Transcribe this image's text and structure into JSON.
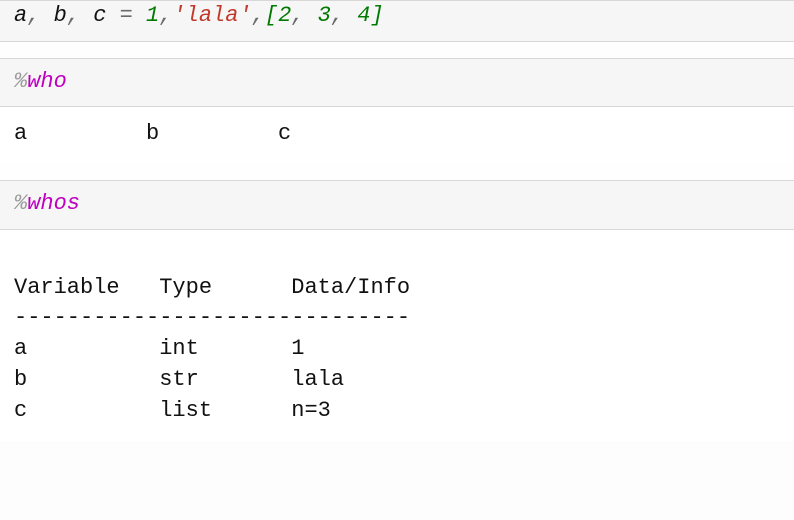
{
  "cell1": {
    "src_a": "a",
    "src_b": "b",
    "src_c": "c",
    "comma_s": ", ",
    "eq": " = ",
    "num1": "1",
    "comma_ns": ",",
    "str_q1": "'",
    "str_body": "lala",
    "str_q2": "'",
    "lb": "[",
    "n2": "2",
    "n3": "3",
    "n4": "4",
    "rb": "]"
  },
  "cell2": {
    "magic_pct": "%",
    "magic_name": "who",
    "output": "a         b         c"
  },
  "cell3": {
    "magic_pct": "%",
    "magic_name": "whos",
    "header": "Variable   Type      Data/Info",
    "rule": "------------------------------",
    "rows": {
      "r0": "a          int       1",
      "r1": "b          str       lala",
      "r2": "c          list      n=3"
    }
  },
  "chart_data": {
    "type": "table",
    "title": "whos output",
    "columns": [
      "Variable",
      "Type",
      "Data/Info"
    ],
    "rows": [
      [
        "a",
        "int",
        "1"
      ],
      [
        "b",
        "str",
        "lala"
      ],
      [
        "c",
        "list",
        "n=3"
      ]
    ]
  }
}
